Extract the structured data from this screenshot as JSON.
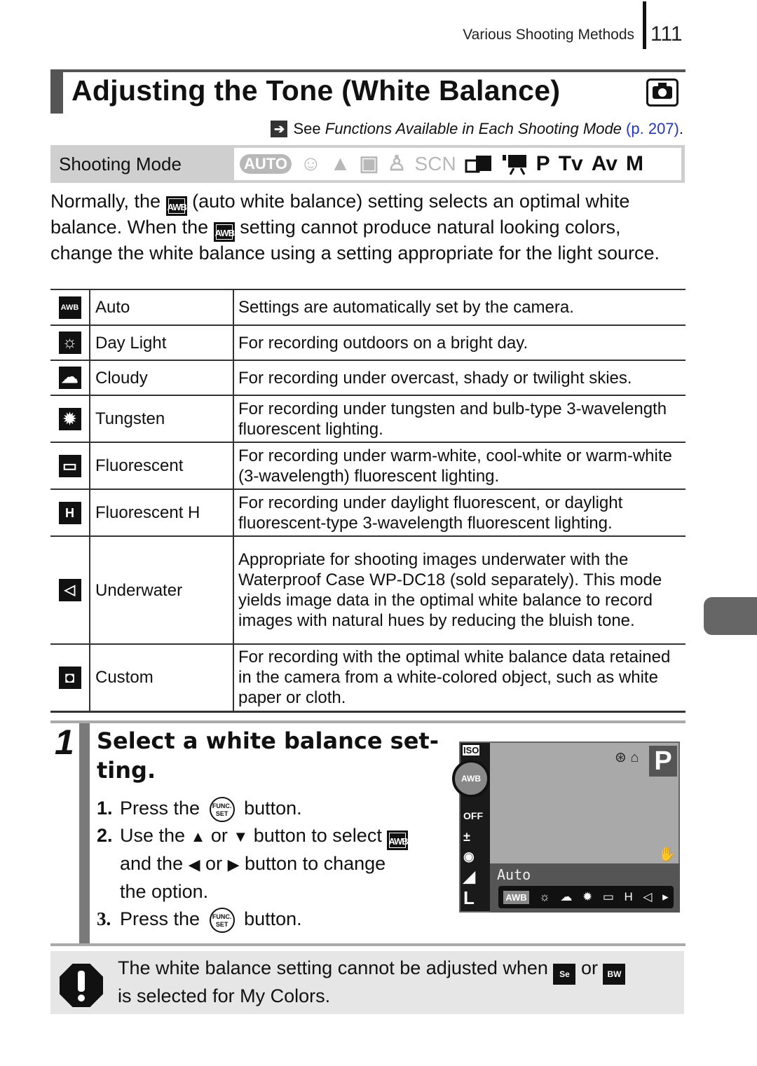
{
  "header": {
    "section": "Various Shooting Methods",
    "page_number": "111"
  },
  "title": "Adjusting the Tone (White Balance)",
  "title_icon": "camera-icon",
  "see_also": {
    "prefix": "See",
    "italic": "Functions Available in Each Shooting Mode",
    "link": "(p. 207)",
    "suffix": ".",
    "link_color": "#2233cc"
  },
  "shooting_mode": {
    "label": "Shooting Mode",
    "modes": [
      {
        "name": "AUTO",
        "available": false
      },
      {
        "name": "Portrait",
        "available": false
      },
      {
        "name": "Landscape",
        "available": false
      },
      {
        "name": "Special Scene",
        "available": false
      },
      {
        "name": "Kids & Pets",
        "available": false
      },
      {
        "name": "SCN",
        "available": false
      },
      {
        "name": "Stitch Assist",
        "available": true
      },
      {
        "name": "Movie",
        "available": true
      },
      {
        "name": "P",
        "available": true
      },
      {
        "name": "Tv",
        "available": true
      },
      {
        "name": "Av",
        "available": true
      },
      {
        "name": "M",
        "available": true
      }
    ]
  },
  "intro": {
    "part1": "Normally, the",
    "part2": "(auto white balance) setting selects an optimal white balance. When the",
    "part3": "setting cannot produce natural looking colors, change the white balance using a setting appropriate for the light source.",
    "awb_icon": "AWB"
  },
  "table": {
    "rows": [
      {
        "icon": "awb-icon",
        "icon_text": "AWB",
        "name": "Auto",
        "description": "Settings are automatically set by the camera."
      },
      {
        "icon": "daylight-icon",
        "icon_text": "☼",
        "name": "Day Light",
        "description": "For recording outdoors on a bright day."
      },
      {
        "icon": "cloudy-icon",
        "icon_text": "☁",
        "name": "Cloudy",
        "description": "For recording under overcast, shady or twilight skies."
      },
      {
        "icon": "tungsten-icon",
        "icon_text": "✹",
        "name": "Tungsten",
        "description": "For recording under tungsten and bulb-type 3-wavelength fluorescent lighting."
      },
      {
        "icon": "fluorescent-icon",
        "icon_text": "▭",
        "name": "Fluorescent",
        "description": "For recording under warm-white, cool-white or warm-white (3-wavelength) fluorescent lighting."
      },
      {
        "icon": "fluorescent-h-icon",
        "icon_text": "H",
        "name": "Fluorescent H",
        "description": "For recording under daylight fluorescent, or daylight fluorescent-type 3-wavelength fluorescent lighting."
      },
      {
        "icon": "underwater-icon",
        "icon_text": "◁",
        "name": "Underwater",
        "description": "Appropriate for shooting images underwater with the Waterproof Case WP-DC18 (sold separately). This mode yields image data in the optimal white balance to record images with natural hues by reducing the bluish tone."
      },
      {
        "icon": "custom-icon",
        "icon_text": "◘",
        "name": "Custom",
        "description": "For recording with the optimal white balance data retained in the camera from a white-colored object, such as white paper or cloth."
      }
    ]
  },
  "step": {
    "number": "1",
    "title": "Select a white balance set-ting.",
    "items": [
      {
        "num": "1.",
        "before": "Press the",
        "button": "FUNC. SET",
        "after": "button.",
        "cont": []
      },
      {
        "num": "2.",
        "before": "Use the",
        "a1": "▲",
        "mid1": "or",
        "a2": "▼",
        "after": "button to select",
        "awb": "AWB",
        "cont": [
          "and the",
          "◀",
          "or",
          "▶",
          "button to change",
          "the option."
        ]
      },
      {
        "num": "3.",
        "before": "Press the",
        "button": "FUNC. SET",
        "after": "button.",
        "cont": []
      }
    ]
  },
  "lcd": {
    "iso": "ISO",
    "selected": "AWB",
    "mode": "P",
    "label": "Auto",
    "side_items": [
      "OFF",
      "±",
      "◉",
      "◢",
      "L"
    ],
    "strip": [
      "AWB",
      "☼",
      "☁",
      "✹",
      "▭",
      "H",
      "◁",
      "▸"
    ]
  },
  "note": {
    "text1": "The white balance setting cannot be adjusted when",
    "icon1": "Se",
    "or": "or",
    "icon2": "BW",
    "text2": "is selected for My Colors."
  }
}
